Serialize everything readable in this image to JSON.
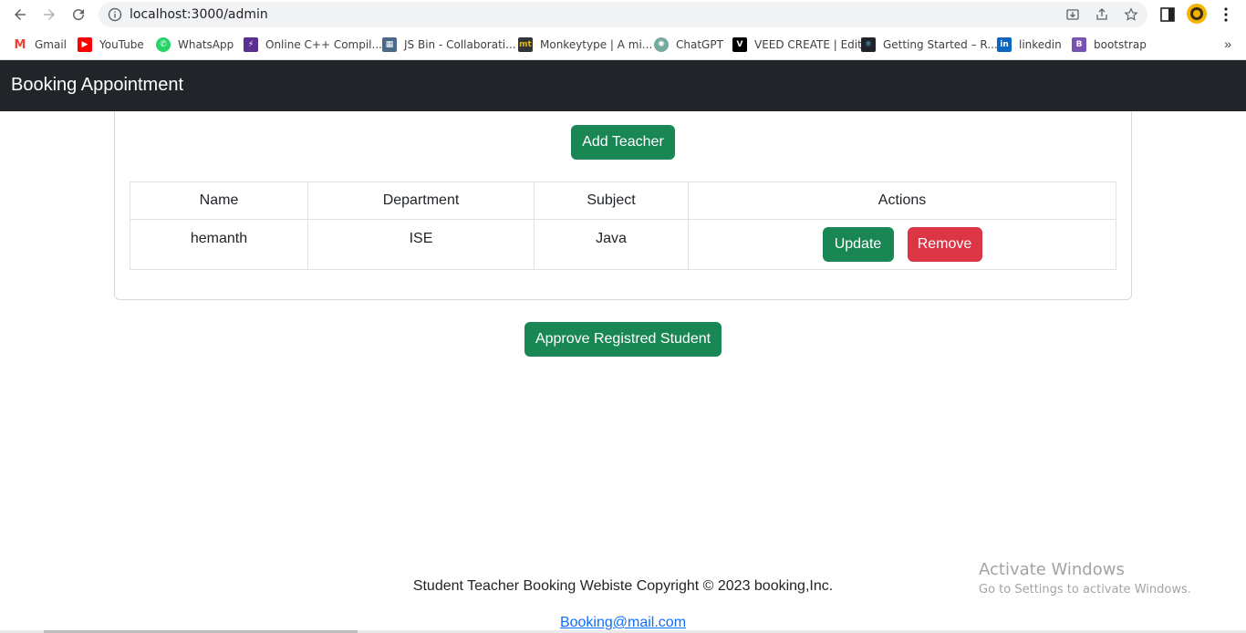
{
  "browser": {
    "url": "localhost:3000/admin",
    "bookmarks": [
      {
        "label": "Gmail",
        "icon": "gmail-icon",
        "color": "#ea4335"
      },
      {
        "label": "YouTube",
        "icon": "youtube-icon",
        "color": "#ff0000"
      },
      {
        "label": "WhatsApp",
        "icon": "whatsapp-icon",
        "color": "#25d366"
      },
      {
        "label": "Online C++ Compil...",
        "icon": "replit-icon",
        "color": "#5b2e91"
      },
      {
        "label": "JS Bin - Collaborati...",
        "icon": "jsbin-icon",
        "color": "#4a6a8a"
      },
      {
        "label": "Monkeytype | A mi...",
        "icon": "monkeytype-icon",
        "color": "#323437"
      },
      {
        "label": "ChatGPT",
        "icon": "chatgpt-icon",
        "color": "#74aa9c"
      },
      {
        "label": "VEED CREATE | Edit",
        "icon": "veed-icon",
        "color": "#000000"
      },
      {
        "label": "Getting Started – R...",
        "icon": "react-icon",
        "color": "#20232a"
      },
      {
        "label": "linkedin",
        "icon": "linkedin-icon",
        "color": "#0a66c2"
      },
      {
        "label": "bootstrap",
        "icon": "bootstrap-icon",
        "color": "#7952b3"
      }
    ]
  },
  "navbar": {
    "brand": "Booking Appointment"
  },
  "card": {
    "add_teacher_label": "Add Teacher"
  },
  "table": {
    "headers": [
      "Name",
      "Department",
      "Subject",
      "Actions"
    ],
    "rows": [
      {
        "name": "hemanth",
        "department": "ISE",
        "subject": "Java",
        "update_label": "Update",
        "remove_label": "Remove"
      }
    ]
  },
  "approve_label": "Approve Registred Student",
  "footer": {
    "text": "Student Teacher Booking Webiste Copyright © 2023 booking,Inc.",
    "email": "Booking@mail.com"
  },
  "watermark": {
    "line1": "Activate Windows",
    "line2": "Go to Settings to activate Windows."
  },
  "colors": {
    "success": "#198754",
    "danger": "#dc3545",
    "navbar": "#212529",
    "link": "#0d6efd"
  }
}
